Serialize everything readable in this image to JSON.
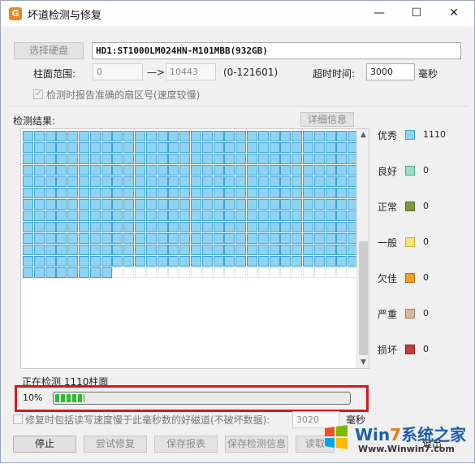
{
  "window": {
    "title": "坏道检测与修复",
    "app_icon_letter": "G",
    "minimize": "—",
    "maximize": "☐",
    "close": "✕"
  },
  "disk": {
    "select_button": "选择硬盘",
    "selected_disk": "HD1:ST1000LM024HN-M101MBB(932GB)"
  },
  "cylinder": {
    "label": "柱面范围:",
    "from": "0",
    "arrow": "—>",
    "to": "10443",
    "range_hint": "(0-121601)"
  },
  "timeout": {
    "label": "超时时间:",
    "value": "3000",
    "unit": "毫秒"
  },
  "report_sector": {
    "label": "检测时报告准确的扇区号(速度较慢)",
    "checked": true
  },
  "results": {
    "label": "检测结果:",
    "detail_button": "详细信息",
    "total_cells": 390,
    "good_cells": 368
  },
  "legend": [
    {
      "label": "优秀",
      "count": "1110",
      "color": "#8fd3f0",
      "border": "#3ca1d3"
    },
    {
      "label": "良好",
      "count": "0",
      "color": "#9fdcc8",
      "border": "#5aa58e"
    },
    {
      "label": "正常",
      "count": "0",
      "color": "#7d9a3a",
      "border": "#55701f"
    },
    {
      "label": "一般",
      "count": "0",
      "color": "#f5e37a",
      "border": "#c9b13e"
    },
    {
      "label": "欠佳",
      "count": "0",
      "color": "#f2a02a",
      "border": "#b86d08"
    },
    {
      "label": "严重",
      "count": "0",
      "color": "#d9b8a0",
      "border": "#a07e64"
    },
    {
      "label": "损坏",
      "count": "0",
      "color": "#c93c3c",
      "border": "#8d1d1d"
    }
  ],
  "status": {
    "text": "正在检测 1110柱面",
    "progress_label": "10%",
    "progress": 0.1
  },
  "repair_option": {
    "label": "修复时包括读写速度慢于此毫秒数的好磁道(不破坏数据):",
    "value": "3020",
    "unit": "毫秒"
  },
  "buttons": {
    "stop": "停止",
    "try_repair": "尝试修复",
    "save_report": "保存报表",
    "save_info": "保存检测信息",
    "read": "读取",
    "exit": "退出"
  },
  "watermark": {
    "brand_prefix": "Win",
    "brand_num": "7",
    "brand_suffix": "系统之家",
    "url": "Www.Winwin7.com"
  }
}
